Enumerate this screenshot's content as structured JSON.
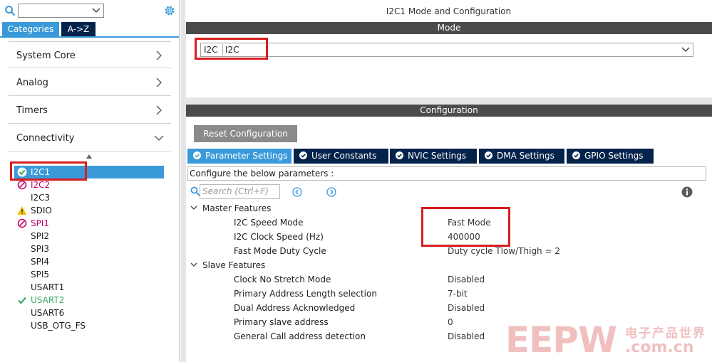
{
  "left": {
    "search_value": "",
    "tabs": [
      "Categories",
      "A->Z"
    ],
    "categories": [
      "System Core",
      "Analog",
      "Timers",
      "Connectivity"
    ],
    "peripherals": [
      {
        "label": "I2C1",
        "status": "ok",
        "color": "#ffffff"
      },
      {
        "label": "I2C2",
        "status": "blocked",
        "color": "#c4006a"
      },
      {
        "label": "I2C3",
        "status": "none",
        "color": "#1e1e1e"
      },
      {
        "label": "SDIO",
        "status": "warning",
        "color": "#1e1e1e"
      },
      {
        "label": "SPI1",
        "status": "blocked",
        "color": "#c4006a"
      },
      {
        "label": "SPI2",
        "status": "none",
        "color": "#1e1e1e"
      },
      {
        "label": "SPI3",
        "status": "none",
        "color": "#1e1e1e"
      },
      {
        "label": "SPI4",
        "status": "none",
        "color": "#1e1e1e"
      },
      {
        "label": "SPI5",
        "status": "none",
        "color": "#1e1e1e"
      },
      {
        "label": "USART1",
        "status": "none",
        "color": "#1e1e1e"
      },
      {
        "label": "USART2",
        "status": "ok",
        "color": "#3daa5c"
      },
      {
        "label": "USART6",
        "status": "none",
        "color": "#1e1e1e"
      },
      {
        "label": "USB_OTG_FS",
        "status": "none",
        "color": "#1e1e1e"
      }
    ]
  },
  "right": {
    "title": "I2C1 Mode and Configuration",
    "mode_header": "Mode",
    "mode_label": "I2C",
    "mode_value": "I2C",
    "config_header": "Configuration",
    "reset_button": "Reset Configuration",
    "tabs": [
      "Parameter Settings",
      "User Constants",
      "NVIC Settings",
      "DMA Settings",
      "GPIO Settings"
    ],
    "hint": "Configure the below parameters :",
    "search_placeholder": "Search (Ctrl+F)",
    "groups": [
      {
        "name": "Master Features",
        "params": [
          {
            "name": "I2C Speed Mode",
            "value": "Fast Mode"
          },
          {
            "name": "I2C Clock Speed (Hz)",
            "value": "400000"
          },
          {
            "name": "Fast Mode Duty Cycle",
            "value": "Duty cycle Tlow/Thigh = 2"
          }
        ]
      },
      {
        "name": "Slave Features",
        "params": [
          {
            "name": "Clock No Stretch Mode",
            "value": "Disabled"
          },
          {
            "name": "Primary Address Length selection",
            "value": "7-bit"
          },
          {
            "name": "Dual Address Acknowledged",
            "value": "Disabled"
          },
          {
            "name": "Primary slave address",
            "value": "0"
          },
          {
            "name": "General Call address detection",
            "value": "Disabled"
          }
        ]
      }
    ]
  },
  "watermark": {
    "big": "EEPW",
    "cn": "电子产品世界",
    "url": ".com.cn"
  },
  "colors": {
    "accent": "#3a9ad9",
    "navy": "#03234b",
    "highlight": "#d81e1e"
  }
}
